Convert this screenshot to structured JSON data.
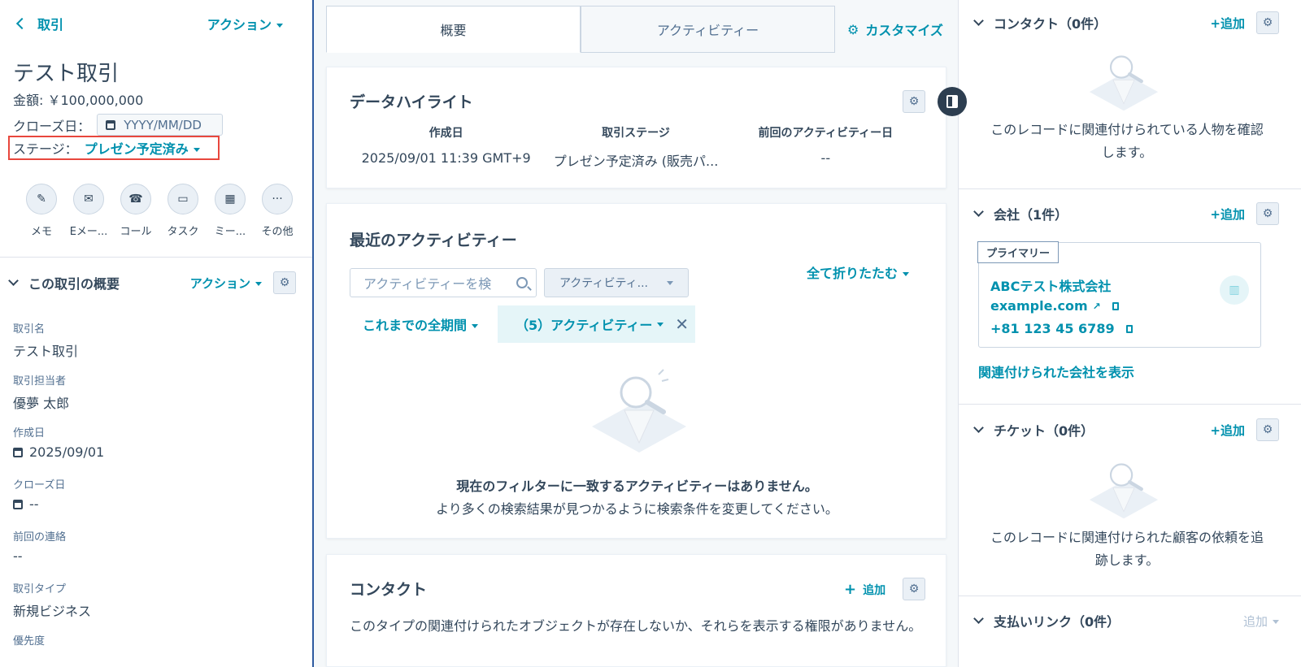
{
  "left": {
    "back_label": "取引",
    "action_label": "アクション",
    "record_title": "テスト取引",
    "amount": "金額: ￥100,000,000",
    "close_date_label": "クローズ日：",
    "close_date_placeholder": "YYYY/MM/DD",
    "stage_label": "ステージ：",
    "stage_value": "プレゼン予定済み",
    "activity_buttons": [
      {
        "label": "メモ",
        "icon": "edit-icon"
      },
      {
        "label": "Eメー...",
        "icon": "email-icon"
      },
      {
        "label": "コール",
        "icon": "phone-icon"
      },
      {
        "label": "タスク",
        "icon": "task-icon"
      },
      {
        "label": "ミー...",
        "icon": "calendar-icon"
      },
      {
        "label": "その他",
        "icon": "more-icon"
      }
    ],
    "summary_title": "この取引の概要",
    "summary_action_label": "アクション",
    "properties": [
      {
        "key": "取引名",
        "value": "テスト取引"
      },
      {
        "key": "取引担当者",
        "value": "優夢 太郎"
      },
      {
        "key": "作成日",
        "value": "2025/09/01"
      },
      {
        "key": "クローズ日",
        "value": "--"
      },
      {
        "key": "前回の連絡",
        "value": "--"
      },
      {
        "key": "取引タイプ",
        "value": "新規ビジネス"
      },
      {
        "key": "優先度",
        "value": ""
      }
    ]
  },
  "tabs": [
    "概要",
    "アクティビティー"
  ],
  "customize_label": "カスタマイズ",
  "highlights": {
    "title": "データハイライト",
    "cols": [
      {
        "key": "作成日",
        "value": "2025/09/01 11:39 GMT+9"
      },
      {
        "key": "取引ステージ",
        "value": "プレゼン予定済み (販売パ..."
      },
      {
        "key": "前回のアクティビティー日",
        "value": "--"
      }
    ]
  },
  "recent": {
    "title": "最近のアクティビティー",
    "search_placeholder": "アクティビティーを検",
    "filter_label": "アクティビティ...",
    "collapse_all": "全て折りたたむ",
    "period": "これまでの全期間",
    "chip": "（5）アクティビティー",
    "empty_title": "現在のフィルターに一致するアクティビティーはありません。",
    "empty_sub": "より多くの検索結果が見つかるように検索条件を変更してください。"
  },
  "contacts_card": {
    "title": "コンタクト",
    "add_label": "追加",
    "text": "このタイプの関連付けられたオブジェクトが存在しないか、それらを表示する権限がありません。"
  },
  "right": {
    "contacts": {
      "title": "コンタクト（0件）",
      "add": "+追加",
      "empty_line1": "このレコードに関連付けられている人物を確認",
      "empty_line2": "します。"
    },
    "companies": {
      "title": "会社（1件）",
      "add": "+追加",
      "primary_tag": "プライマリー",
      "name": "ABCテスト株式会社",
      "domain": "example.com",
      "phone": "+81 123 45 6789",
      "view_link": "関連付けられた会社を表示"
    },
    "tickets": {
      "title": "チケット（0件）",
      "add": "+追加",
      "empty_line1": "このレコードに関連付けられた顧客の依頼を追",
      "empty_line2": "跡します。"
    },
    "payments": {
      "title": "支払いリンク（0件）",
      "add": "追加"
    }
  },
  "colors": {
    "accent": "#0091ae",
    "text": "#33475b",
    "highlight_border": "#e8473d"
  }
}
